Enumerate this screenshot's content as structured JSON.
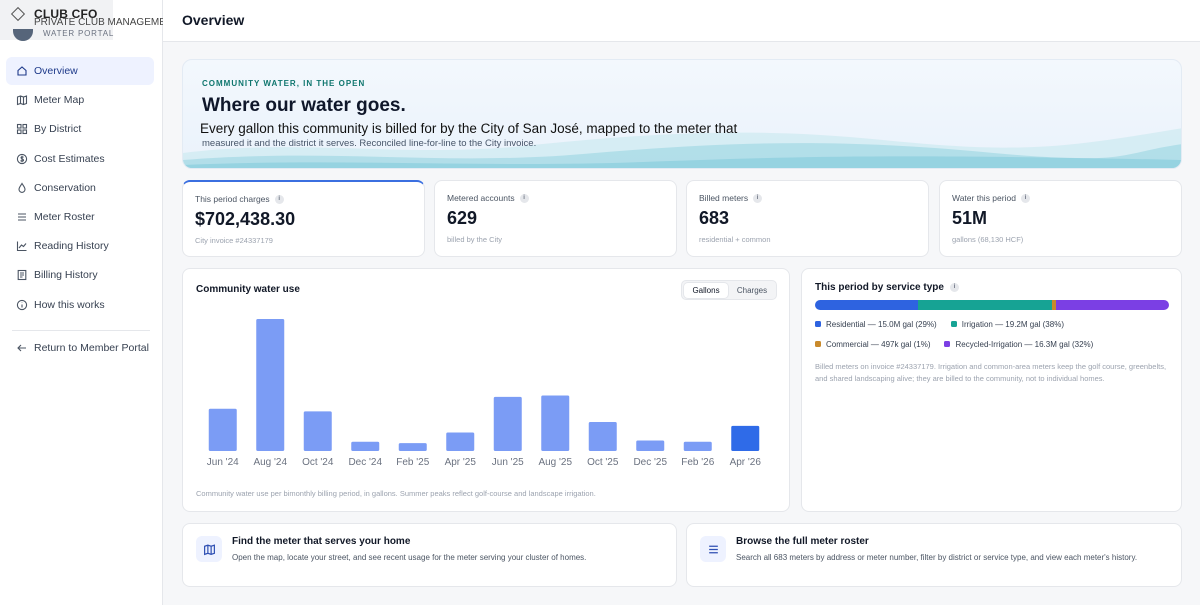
{
  "brand": {
    "name": "CLUB CFO",
    "tagline": "PRIVATE CLUB MANAGEMENT",
    "portal": "WATER PORTAL"
  },
  "nav": {
    "items": [
      {
        "label": "Overview",
        "icon": "home-icon",
        "active": true
      },
      {
        "label": "Meter Map",
        "icon": "map-icon"
      },
      {
        "label": "By District",
        "icon": "grid-icon"
      },
      {
        "label": "Cost Estimates",
        "icon": "dollar-icon"
      },
      {
        "label": "Conservation",
        "icon": "droplet-icon"
      },
      {
        "label": "Meter Roster",
        "icon": "list-icon"
      },
      {
        "label": "Reading History",
        "icon": "line-chart-icon"
      },
      {
        "label": "Billing History",
        "icon": "receipt-icon"
      },
      {
        "label": "How this works",
        "icon": "info-icon"
      }
    ],
    "return_label": "Return to Member Portal"
  },
  "header": {
    "title": "Overview"
  },
  "hero": {
    "eyebrow": "COMMUNITY WATER, IN THE OPEN",
    "title": "Where our water goes.",
    "desc_line1": "Every gallon this community is billed for by the City of San José, mapped to the meter that",
    "desc_line2": "measured it and the district it serves. Reconciled line-for-line to the City invoice."
  },
  "kpis": [
    {
      "label": "This period charges",
      "value": "$702,438.30",
      "sub": "City invoice #24337179"
    },
    {
      "label": "Metered accounts",
      "value": "629",
      "sub": "billed by the City"
    },
    {
      "label": "Billed meters",
      "value": "683",
      "sub": "residential + common"
    },
    {
      "label": "Water this period",
      "value": "51M",
      "sub": "gallons (68,130 HCF)"
    }
  ],
  "usage_card": {
    "title": "Community water use",
    "toggle": {
      "gallons": "Gallons",
      "charges": "Charges",
      "selected": "gallons"
    },
    "footnote": "Community water use per bimonthly billing period, in gallons. Summer peaks reflect golf-course and landscape irrigation."
  },
  "chart_data": {
    "type": "bar",
    "categories": [
      "Jun '24",
      "Aug '24",
      "Oct '24",
      "Dec '24",
      "Feb '25",
      "Apr '25",
      "Jun '25",
      "Aug '25",
      "Oct '25",
      "Dec '25",
      "Feb '26",
      "Apr '26"
    ],
    "values": [
      32,
      100,
      30,
      7,
      6,
      14,
      41,
      42,
      22,
      8,
      7,
      19
    ],
    "highlight_index": 11,
    "colors": {
      "bar": "#7b9cf5",
      "highlight": "#2f6be8",
      "tick": "#6b7280"
    },
    "title": "",
    "xlabel": "",
    "ylabel": "",
    "grid": false
  },
  "service_card": {
    "title": "This period by service type",
    "segments": [
      {
        "name": "Residential",
        "label": "Residential — 15.0M gal (29%)",
        "share": 29,
        "color": "#2e63e0"
      },
      {
        "name": "Irrigation",
        "label": "Irrigation — 19.2M gal (38%)",
        "share": 38,
        "color": "#16a394"
      },
      {
        "name": "Commercial",
        "label": "Commercial — 497k gal (1%)",
        "share": 1,
        "color": "#c98a2c"
      },
      {
        "name": "Recycled-Irrigation",
        "label": "Recycled-Irrigation — 16.3M gal (32%)",
        "share": 32,
        "color": "#7b3fe4"
      }
    ],
    "note": "Billed meters on invoice #24337179. Irrigation and common-area meters keep the golf course, greenbelts, and shared landscaping alive; they are billed to the community, not to individual homes."
  },
  "actions": [
    {
      "title": "Find the meter that serves your home",
      "desc": "Open the map, locate your street, and see recent usage for the meter serving your cluster of homes.",
      "icon": "map-icon"
    },
    {
      "title": "Browse the full meter roster",
      "desc": "Search all 683 meters by address or meter number, filter by district or service type, and view each meter's history.",
      "icon": "list-icon"
    }
  ]
}
